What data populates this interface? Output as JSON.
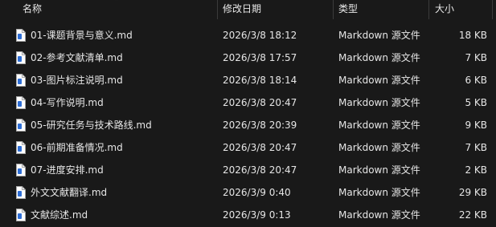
{
  "columns": {
    "name": "名称",
    "date": "修改日期",
    "type": "类型",
    "size": "大小"
  },
  "files": [
    {
      "name": "01-课题背景与意义.md",
      "date": "2026/3/8 18:12",
      "type": "Markdown 源文件",
      "size": "18 KB",
      "icon": "document-icon"
    },
    {
      "name": "02-参考文献清单.md",
      "date": "2026/3/8 17:57",
      "type": "Markdown 源文件",
      "size": "7 KB",
      "icon": "document-icon"
    },
    {
      "name": "03-图片标注说明.md",
      "date": "2026/3/8 18:14",
      "type": "Markdown 源文件",
      "size": "6 KB",
      "icon": "document-icon"
    },
    {
      "name": "04-写作说明.md",
      "date": "2026/3/8 20:47",
      "type": "Markdown 源文件",
      "size": "5 KB",
      "icon": "document-icon"
    },
    {
      "name": "05-研究任务与技术路线.md",
      "date": "2026/3/8 20:39",
      "type": "Markdown 源文件",
      "size": "9 KB",
      "icon": "document-icon"
    },
    {
      "name": "06-前期准备情况.md",
      "date": "2026/3/8 20:47",
      "type": "Markdown 源文件",
      "size": "7 KB",
      "icon": "document-icon"
    },
    {
      "name": "07-进度安排.md",
      "date": "2026/3/8 20:47",
      "type": "Markdown 源文件",
      "size": "2 KB",
      "icon": "document-icon"
    },
    {
      "name": "外文文献翻译.md",
      "date": "2026/3/9 0:40",
      "type": "Markdown 源文件",
      "size": "29 KB",
      "icon": "document-icon"
    },
    {
      "name": "文献综述.md",
      "date": "2026/3/9 0:13",
      "type": "Markdown 源文件",
      "size": "22 KB",
      "icon": "document-icon"
    }
  ]
}
